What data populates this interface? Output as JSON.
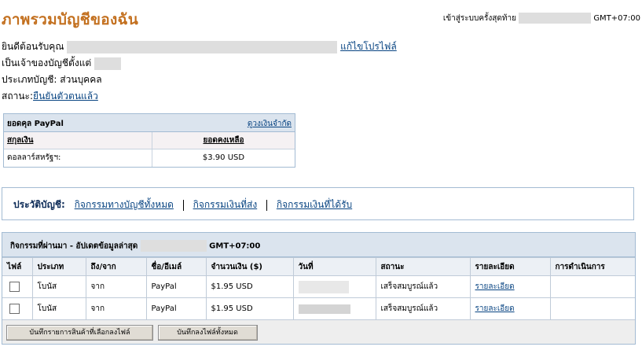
{
  "header": {
    "title": "ภาพรวมบัญชีของฉัน",
    "last_login_label": "เข้าสู่ระบบครั้งสุดท้าย",
    "last_login_tz": "GMT+07:00"
  },
  "profile": {
    "welcome_label": "ยินดีต้อนรับคุณ",
    "edit_profile_link": "แก้ไขโปรไฟล์",
    "owner_since_label": "เป็นเจ้าของบัญชีตั้งแต่",
    "account_type_label": "ประเภทบัญชี:",
    "account_type_value": "ส่วนบุคคล",
    "status_label": "สถานะ:",
    "status_value": "ยืนยันตัวตนแล้ว"
  },
  "balance": {
    "title": "ยอดคุล PayPal",
    "limit_link": "ดูวงเงินจำกัด",
    "col_currency": "สกุลเงิน",
    "col_balance": "ยอดคงเหลือ",
    "rows": [
      {
        "currency": "ดอลลาร์สหรัฐฯ:",
        "amount": "$3.90 USD"
      }
    ]
  },
  "history": {
    "label": "ประวัติบัญชี:",
    "links": [
      "กิจกรรมทางบัญชีทั้งหมด",
      "กิจกรรมเงินที่ส่ง",
      "กิจกรรมเงินที่ได้รับ"
    ]
  },
  "activity": {
    "title_prefix": "กิจกรรมที่ผ่านมา - อัปเดตข้อมูลล่าสุด",
    "title_tz": "GMT+07:00",
    "columns": [
      "ไฟล์",
      "ประเภท",
      "ถึง/จาก",
      "ชื่อ/อีเมล์",
      "จำนวนเงิน ($)",
      "วันที่",
      "สถานะ",
      "รายละเอียด",
      "การดำเนินการ"
    ],
    "rows": [
      {
        "type": "โบนัส",
        "to_from": "จาก",
        "name": "PayPal",
        "amount": "$1.95 USD",
        "status": "เสร็จสมบูรณ์แล้ว",
        "details": "รายละเอียด"
      },
      {
        "type": "โบนัส",
        "to_from": "จาก",
        "name": "PayPal",
        "amount": "$1.95 USD",
        "status": "เสร็จสมบูรณ์แล้ว",
        "details": "รายละเอียด"
      }
    ],
    "buttons": {
      "save_selected": "บันทึกรายการสินค้าที่เลือกลงไฟล์",
      "save_all": "บันทึกลงไฟล์ทั้งหมด"
    }
  },
  "colors": {
    "title": "#c3701f",
    "link": "#084482",
    "panel_header": "#dbe4ee",
    "border": "#a3bbd3"
  }
}
